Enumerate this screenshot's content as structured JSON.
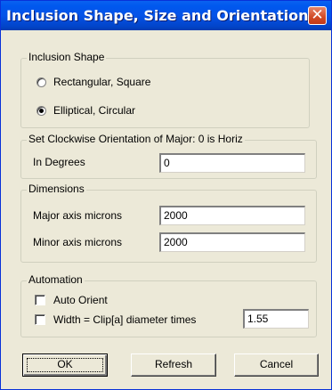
{
  "window": {
    "title": "Inclusion Shape, Size and  Orientation",
    "close_glyph": "✕"
  },
  "inclusion_shape": {
    "legend": "Inclusion Shape",
    "options": [
      {
        "label": "Rectangular, Square",
        "selected": false
      },
      {
        "label": "Elliptical, Circular",
        "selected": true
      }
    ]
  },
  "orientation": {
    "legend": "Set Clockwise Orientation of Major: 0 is Horiz",
    "label": "In Degrees",
    "value": "0"
  },
  "dimensions": {
    "legend": "Dimensions",
    "major_label": "Major axis microns",
    "major_value": "2000",
    "minor_label": "Minor axis microns",
    "minor_value": "2000"
  },
  "automation": {
    "legend": "Automation",
    "auto_orient_label": "Auto Orient",
    "auto_orient_checked": false,
    "width_label": "Width = Clip[a] diameter times",
    "width_checked": false,
    "width_value": "1.55"
  },
  "buttons": {
    "ok": "OK",
    "refresh": "Refresh",
    "cancel": "Cancel"
  }
}
